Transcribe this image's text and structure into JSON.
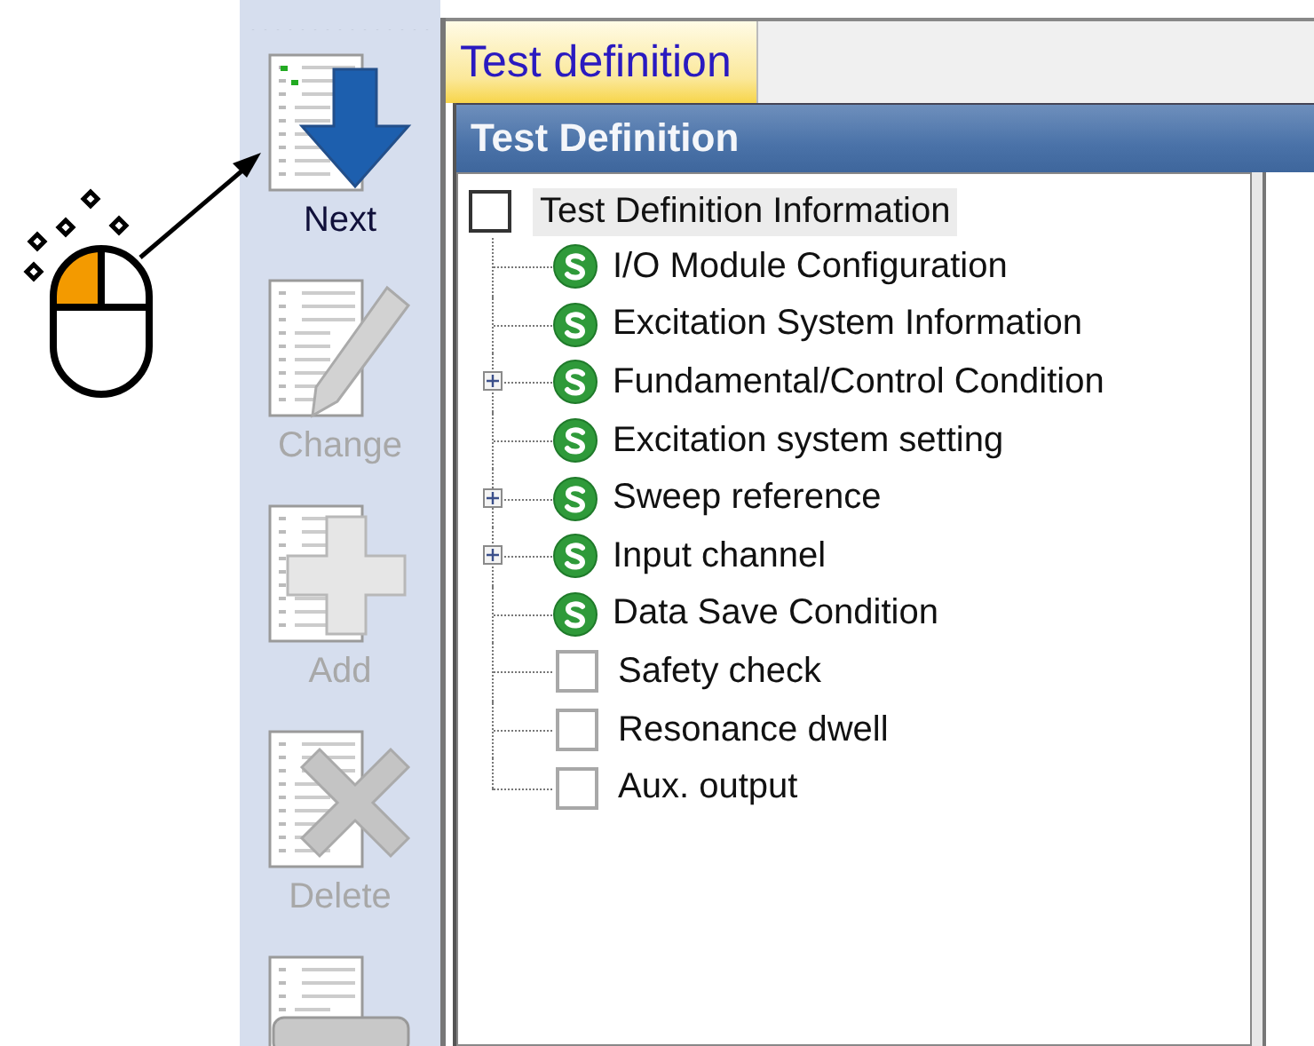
{
  "toolbar": [
    {
      "kind": "next",
      "label": "Next",
      "disabled": false
    },
    {
      "kind": "change",
      "label": "Change",
      "disabled": true
    },
    {
      "kind": "add",
      "label": "Add",
      "disabled": true
    },
    {
      "kind": "delete",
      "label": "Delete",
      "disabled": true
    },
    {
      "kind": "off"
    }
  ],
  "tabs": [
    {
      "label": "Test definition",
      "selected": true
    }
  ],
  "panel": {
    "title": "Test Definition"
  },
  "tree": {
    "label": "Test Definition Information",
    "checked": false,
    "selected": true,
    "children": [
      {
        "kind": "status",
        "label": "I/O Module Configuration",
        "collapsed": false,
        "selected": false
      },
      {
        "kind": "status",
        "label": "Excitation System Information",
        "collapsed": false,
        "selected": false
      },
      {
        "kind": "status",
        "label": "Fundamental/Control Condition",
        "collapsed": true,
        "selected": false
      },
      {
        "kind": "status",
        "label": "Excitation system setting",
        "collapsed": false,
        "selected": false
      },
      {
        "kind": "status",
        "label": "Sweep reference",
        "collapsed": true,
        "selected": false
      },
      {
        "kind": "status",
        "label": "Input channel",
        "collapsed": true,
        "selected": false
      },
      {
        "kind": "status",
        "label": "Data Save Condition",
        "collapsed": false,
        "selected": false
      },
      {
        "kind": "checkbox",
        "label": "Safety check",
        "checked": false,
        "collapsed": false,
        "selected": false
      },
      {
        "kind": "checkbox",
        "label": "Resonance dwell",
        "checked": false,
        "collapsed": false,
        "selected": false
      },
      {
        "kind": "checkbox",
        "label": "Aux. output",
        "checked": false,
        "collapsed": false,
        "selected": false
      }
    ]
  }
}
